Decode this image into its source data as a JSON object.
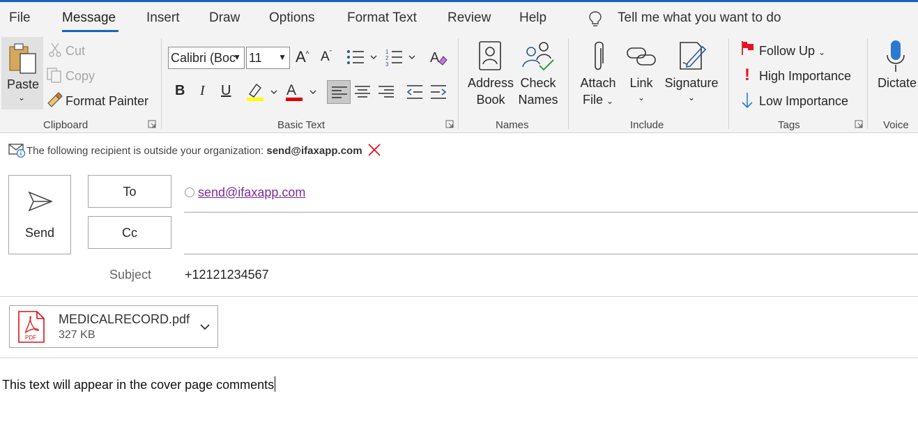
{
  "menu": {
    "tabs": [
      "File",
      "Message",
      "Insert",
      "Draw",
      "Options",
      "Format Text",
      "Review",
      "Help"
    ],
    "active_tab": "Message",
    "tell_me": "Tell me what you want to do"
  },
  "ribbon": {
    "clipboard": {
      "paste": "Paste",
      "cut": "Cut",
      "copy": "Copy",
      "format_painter": "Format Painter",
      "group_label": "Clipboard"
    },
    "basic_text": {
      "font_name": "Calibri (Boc",
      "font_size": "11",
      "bold": "B",
      "italic": "I",
      "underline": "U",
      "highlight_color": "#ffff00",
      "font_color": "#e00000",
      "group_label": "Basic Text"
    },
    "names": {
      "address_book_line1": "Address",
      "address_book_line2": "Book",
      "check_names_line1": "Check",
      "check_names_line2": "Names",
      "group_label": "Names"
    },
    "include": {
      "attach_line1": "Attach",
      "attach_line2": "File",
      "link": "Link",
      "signature": "Signature",
      "group_label": "Include"
    },
    "tags": {
      "follow_up": "Follow Up",
      "high_importance": "High Importance",
      "low_importance": "Low Importance",
      "group_label": "Tags"
    },
    "voice": {
      "dictate": "Dictate",
      "group_label": "Voice"
    }
  },
  "warning": {
    "text": "The following recipient is outside your organization:",
    "email": "send@ifaxapp.com"
  },
  "compose": {
    "send": "Send",
    "to_label": "To",
    "cc_label": "Cc",
    "to_recipient": "send@ifaxapp.com",
    "subject_label": "Subject",
    "subject_value": "+12121234567"
  },
  "attachment": {
    "name": "MEDICALRECORD.pdf",
    "size": "327 KB",
    "icon_text": "PDF"
  },
  "body": {
    "text": "This text will appear in the cover page comments"
  },
  "colors": {
    "accent": "#1565c0",
    "link_visited": "#7b2c94",
    "error_red": "#e81123"
  }
}
